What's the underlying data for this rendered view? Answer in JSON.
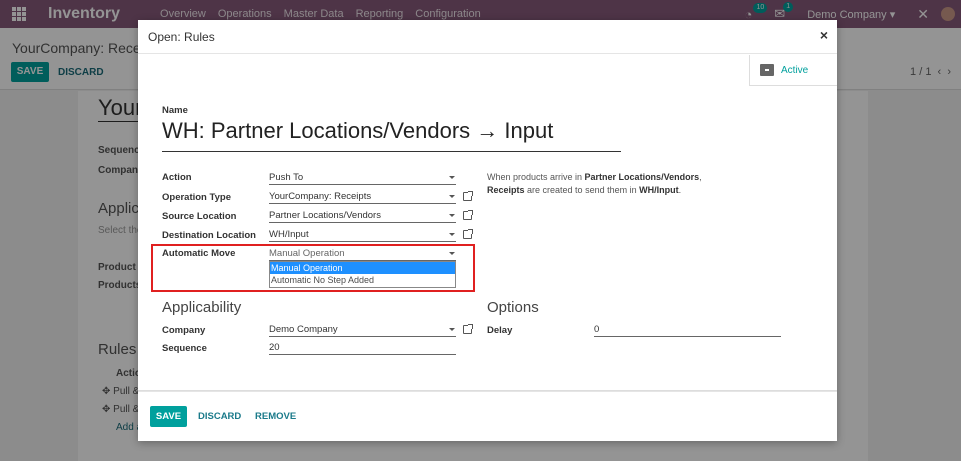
{
  "navbar": {
    "app_name": "Inventory",
    "menu": [
      "Overview",
      "Operations",
      "Master Data",
      "Reporting",
      "Configuration"
    ],
    "activity_badge": "10",
    "messages_badge": "1",
    "company": "Demo Company"
  },
  "control_panel": {
    "breadcrumb": "YourCompany: Receive",
    "save_label": "SAVE",
    "discard_label": "DISCARD",
    "pager": "1 / 1"
  },
  "background": {
    "title": "Your",
    "sequence_label": "Sequence",
    "company_label": "Company",
    "applicability_label": "Applica",
    "select_hint": "Select the",
    "product_label": "Product C",
    "products_label": "Products",
    "rules_label": "Rules",
    "action_col": "Action",
    "row1": "Pull &",
    "row2": "Pull &",
    "add_line": "Add a"
  },
  "modal": {
    "title": "Open: Rules",
    "active_label": "Active",
    "name_label": "Name",
    "name_value": "WH: Partner Locations/Vendors → Input",
    "fields": {
      "action": {
        "label": "Action",
        "value": "Push To"
      },
      "operation_type": {
        "label": "Operation Type",
        "value": "YourCompany: Receipts"
      },
      "source_location": {
        "label": "Source Location",
        "value": "Partner Locations/Vendors"
      },
      "destination_location": {
        "label": "Destination Location",
        "value": "WH/Input"
      },
      "automatic_move": {
        "label": "Automatic Move",
        "value": "Manual Operation"
      }
    },
    "dropdown_options": [
      "Manual Operation",
      "Automatic No Step Added"
    ],
    "help": {
      "p1": "When products arrive in ",
      "b1": "Partner Locations/Vendors",
      "p2": ", ",
      "b2": "Receipts",
      "p3": " are created to send them in ",
      "b3": "WH/Input",
      "p4": "."
    },
    "applicability": {
      "heading": "Applicability",
      "company_label": "Company",
      "company_value": "Demo Company",
      "sequence_label": "Sequence",
      "sequence_value": "20"
    },
    "options": {
      "heading": "Options",
      "delay_label": "Delay",
      "delay_value": "0"
    },
    "footer": {
      "save": "SAVE",
      "discard": "DISCARD",
      "remove": "REMOVE"
    }
  },
  "colors": {
    "navbar": "#875a7b",
    "primary": "#00a09d",
    "highlight": "#e02020",
    "selected_option": "#1e90ff"
  }
}
